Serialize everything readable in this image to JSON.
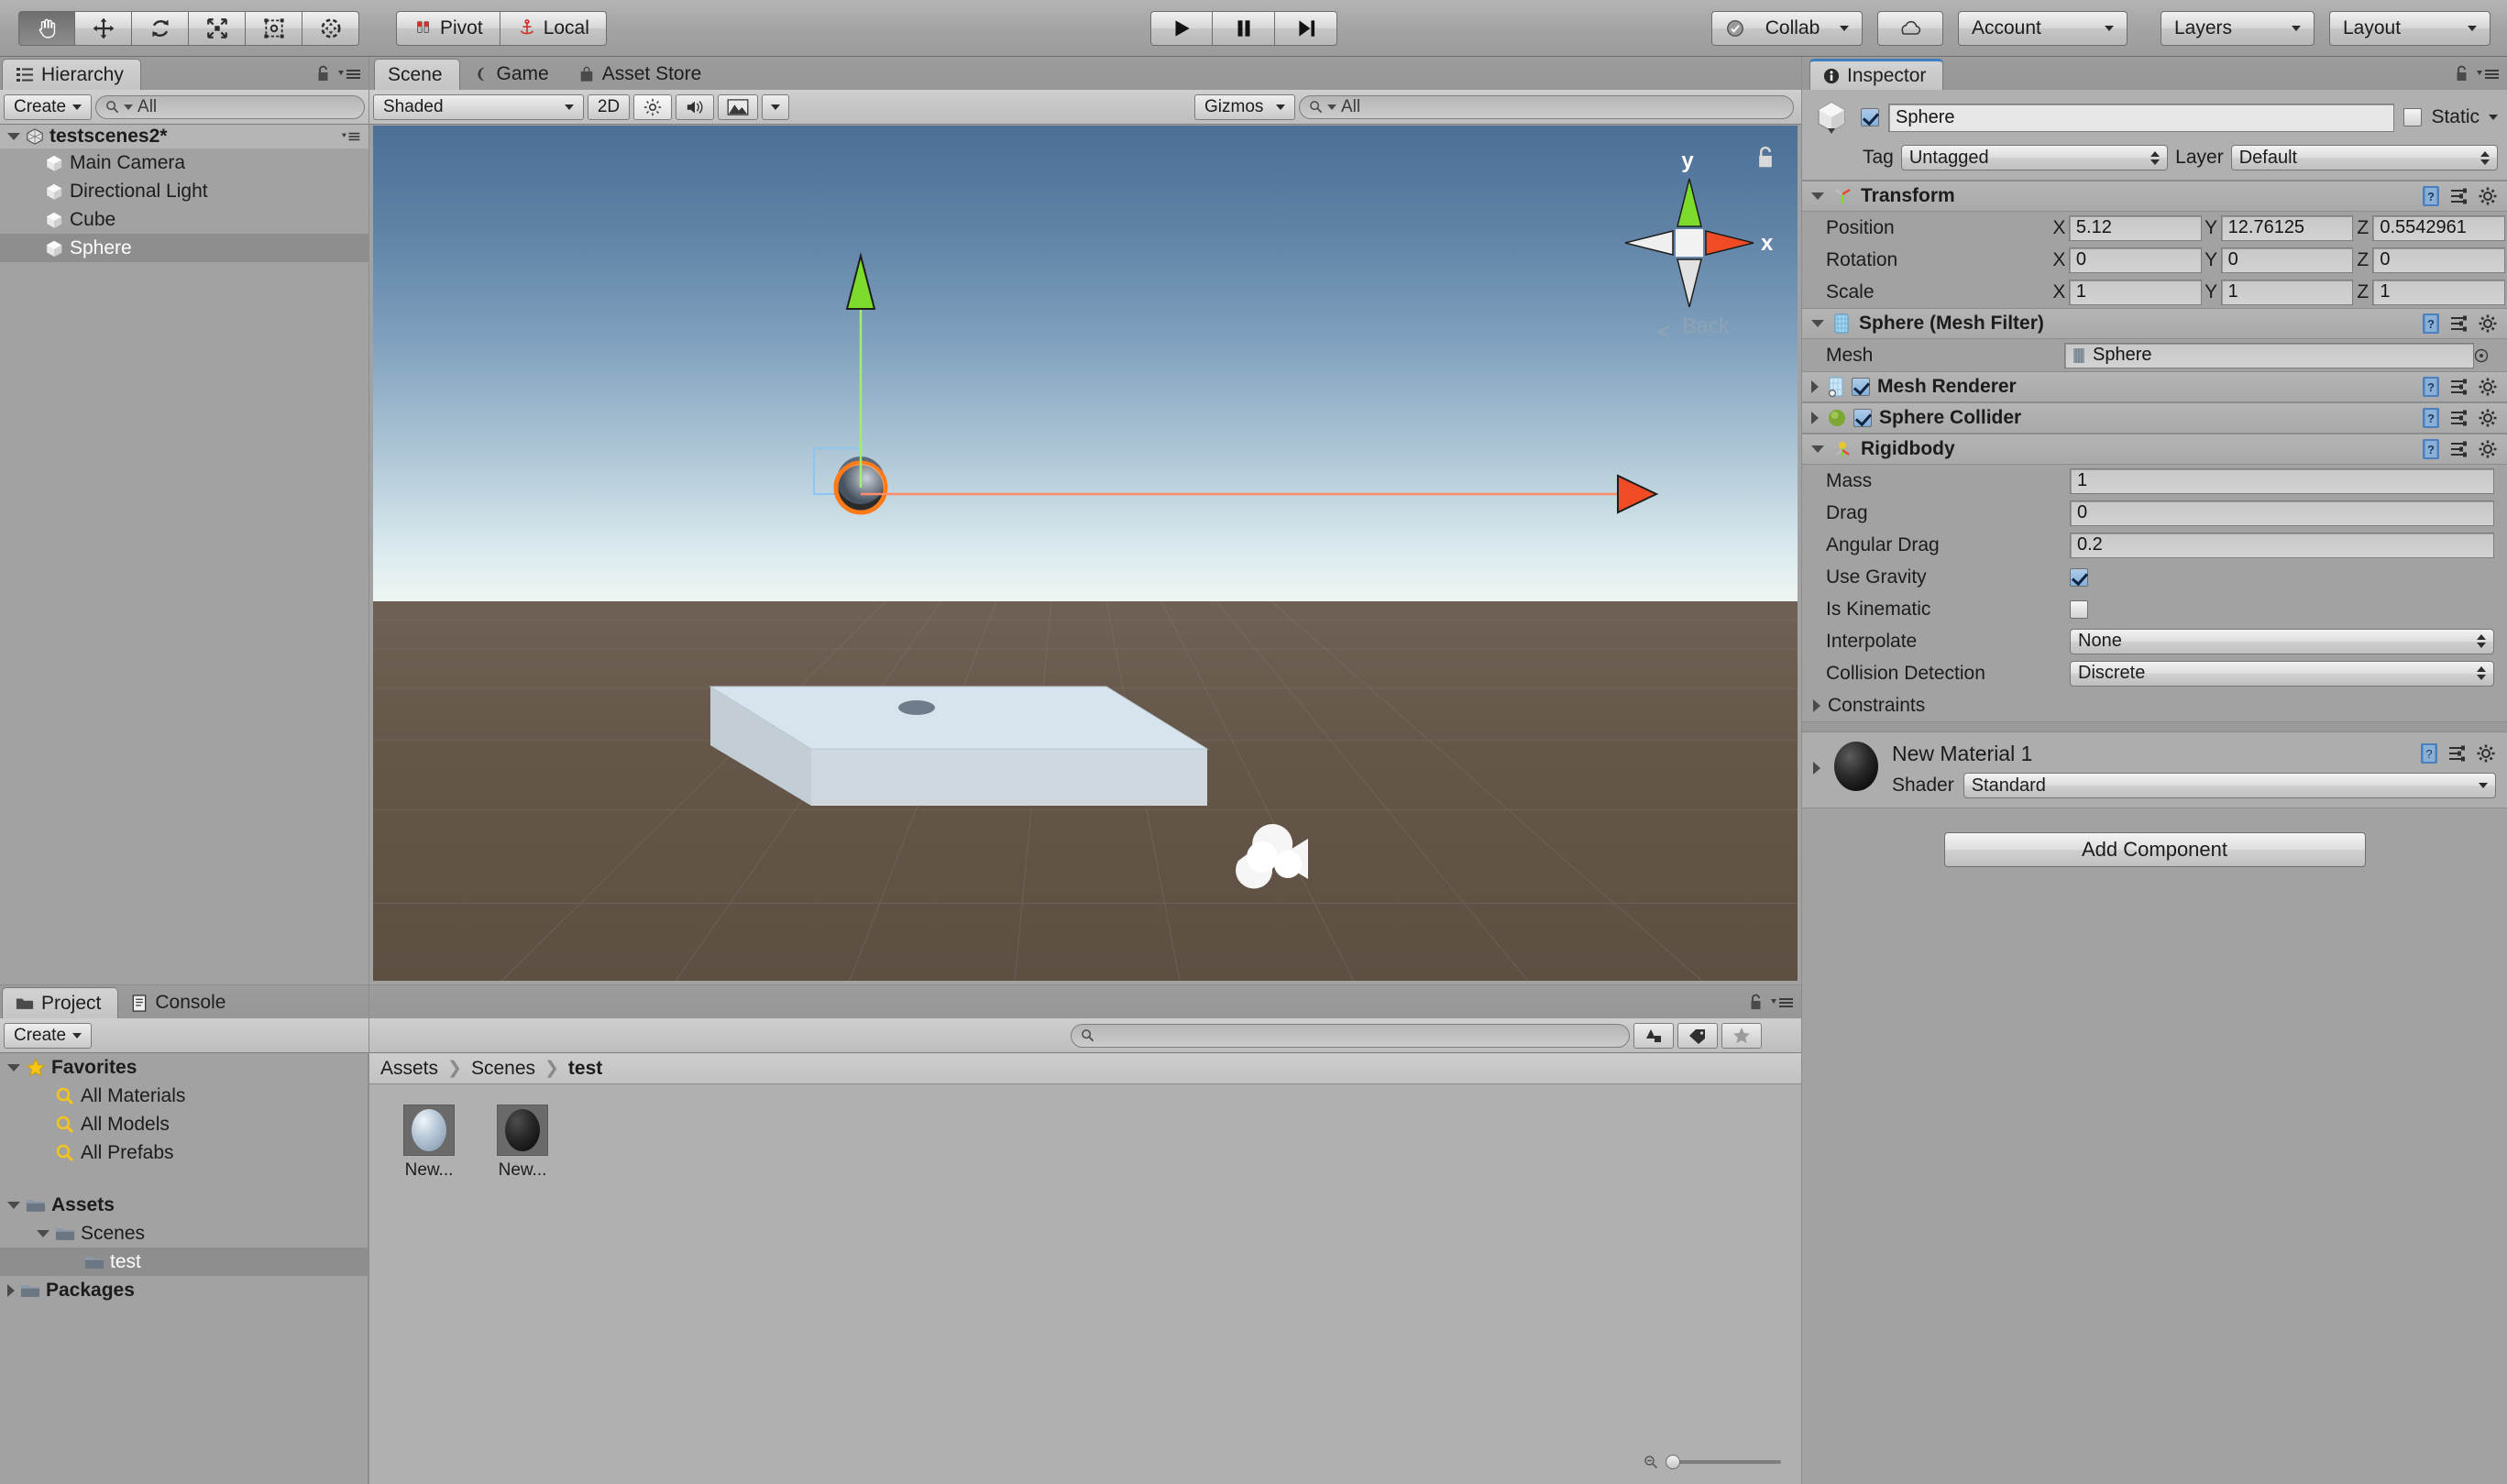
{
  "app": {
    "name": "Unity Editor"
  },
  "toolbar": {
    "tools": [
      {
        "name": "hand-tool",
        "label": "Hand",
        "active": true
      },
      {
        "name": "move-tool",
        "label": "Move",
        "active": false
      },
      {
        "name": "rotate-tool",
        "label": "Rotate",
        "active": false
      },
      {
        "name": "scale-tool",
        "label": "Scale",
        "active": false
      },
      {
        "name": "rect-tool",
        "label": "Rect",
        "active": false
      },
      {
        "name": "transform-tool",
        "label": "Transform",
        "active": false
      }
    ],
    "pivot_label": "Pivot",
    "local_label": "Local",
    "play_label": "Play",
    "pause_label": "Pause",
    "step_label": "Step",
    "collab_label": "Collab",
    "cloud_label": "Cloud",
    "account_label": "Account",
    "layers_label": "Layers",
    "layout_label": "Layout"
  },
  "hierarchy": {
    "tab_label": "Hierarchy",
    "create_label": "Create",
    "search_placeholder": "All",
    "search_value": "",
    "scene_name": "testscenes2*",
    "items": [
      {
        "label": "Main Camera",
        "selected": false
      },
      {
        "label": "Directional Light",
        "selected": false
      },
      {
        "label": "Cube",
        "selected": false
      },
      {
        "label": "Sphere",
        "selected": true
      }
    ]
  },
  "scene": {
    "tabs": [
      {
        "label": "Scene",
        "active": true
      },
      {
        "label": "Game",
        "active": false
      },
      {
        "label": "Asset Store",
        "active": false
      }
    ],
    "draw_mode": "Shaded",
    "toggle_2d": "2D",
    "lighting_label": "Lighting",
    "audio_label": "Audio",
    "fx_label": "Effects",
    "gizmos_label": "Gizmos",
    "search_placeholder": "All",
    "search_value": "",
    "axis_gizmo": {
      "x": "x",
      "y": "y",
      "back": "Back"
    }
  },
  "inspector": {
    "tab_label": "Inspector",
    "object_name": "Sphere",
    "object_enabled": true,
    "static_label": "Static",
    "static_checked": false,
    "tag_label": "Tag",
    "tag_value": "Untagged",
    "layer_label": "Layer",
    "layer_value": "Default",
    "transform": {
      "title": "Transform",
      "rows": [
        {
          "label": "Position",
          "x": "5.12",
          "y": "12.76125",
          "z": "0.5542961"
        },
        {
          "label": "Rotation",
          "x": "0",
          "y": "0",
          "z": "0"
        },
        {
          "label": "Scale",
          "x": "1",
          "y": "1",
          "z": "1"
        }
      ],
      "axis_labels": [
        "X",
        "Y",
        "Z"
      ]
    },
    "mesh_filter": {
      "title": "Sphere (Mesh Filter)",
      "mesh_label": "Mesh",
      "mesh_value": "Sphere"
    },
    "mesh_renderer": {
      "title": "Mesh Renderer",
      "enabled": true
    },
    "sphere_collider": {
      "title": "Sphere Collider",
      "enabled": true
    },
    "rigidbody": {
      "title": "Rigidbody",
      "mass_label": "Mass",
      "mass_value": "1",
      "drag_label": "Drag",
      "drag_value": "0",
      "angular_drag_label": "Angular Drag",
      "angular_drag_value": "0.2",
      "use_gravity_label": "Use Gravity",
      "use_gravity": true,
      "is_kinematic_label": "Is Kinematic",
      "is_kinematic": false,
      "interpolate_label": "Interpolate",
      "interpolate_value": "None",
      "collision_detection_label": "Collision Detection",
      "collision_detection_value": "Discrete",
      "constraints_label": "Constraints"
    },
    "material": {
      "title": "New Material 1",
      "shader_label": "Shader",
      "shader_value": "Standard"
    },
    "add_component_label": "Add Component"
  },
  "project": {
    "tabs": [
      {
        "label": "Project",
        "active": true
      },
      {
        "label": "Console",
        "active": false
      }
    ],
    "create_label": "Create",
    "search_placeholder": "",
    "search_value": "",
    "tree": [
      {
        "label": "Favorites",
        "depth": 0,
        "type": "star",
        "expanded": true,
        "bold": true
      },
      {
        "label": "All Materials",
        "depth": 1,
        "type": "search",
        "bold": false
      },
      {
        "label": "All Models",
        "depth": 1,
        "type": "search",
        "bold": false
      },
      {
        "label": "All Prefabs",
        "depth": 1,
        "type": "search",
        "bold": false
      },
      {
        "label": "",
        "depth": 0,
        "type": "spacer",
        "bold": false
      },
      {
        "label": "Assets",
        "depth": 0,
        "type": "folder",
        "expanded": true,
        "bold": true
      },
      {
        "label": "Scenes",
        "depth": 1,
        "type": "folder",
        "expanded": true,
        "bold": false
      },
      {
        "label": "test",
        "depth": 2,
        "type": "folder",
        "selected": true,
        "bold": false
      },
      {
        "label": "Packages",
        "depth": 0,
        "type": "folder",
        "expanded": false,
        "bold": true
      }
    ],
    "breadcrumb": [
      "Assets",
      "Scenes",
      "test"
    ],
    "assets": [
      {
        "label": "New...",
        "kind": "material-light"
      },
      {
        "label": "New...",
        "kind": "material-dark"
      }
    ],
    "zoom_value": 0
  },
  "colors": {
    "panel_bg": "#a2a2a2",
    "accent_blue": "#3f7fbf",
    "selection": "#8e8e8e",
    "axis_x": "#e8472a",
    "axis_y": "#7ddb2c",
    "axis_z": "#2a6ee8",
    "highlight_orange": "#ff7a18"
  }
}
